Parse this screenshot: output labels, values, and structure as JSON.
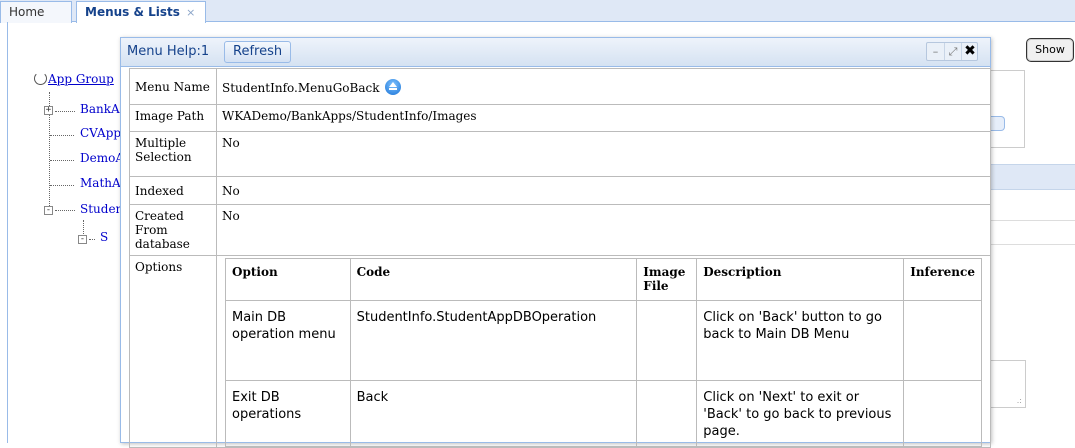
{
  "tabs": [
    {
      "label": "Home"
    },
    {
      "label": "Menus & Lists",
      "close": "×"
    }
  ],
  "background": {
    "tree_root_label": "App Group",
    "tree_items": [
      "BankA",
      "CVApp",
      "DemoA",
      "MathA",
      "Student",
      "S"
    ],
    "show_button": "Show"
  },
  "dialog": {
    "title": "Menu Help:1",
    "refresh_label": "Refresh",
    "tools": {
      "minimize": "–",
      "maximize": "⤢",
      "close": "✖"
    },
    "properties": {
      "menu_name": {
        "label": "Menu Name",
        "value": "StudentInfo.MenuGoBack",
        "icon": "go-back-icon"
      },
      "image_path": {
        "label": "Image Path",
        "value": "WKADemo/BankApps/StudentInfo/Images"
      },
      "multiple_selection": {
        "label": "Multiple Selection",
        "value": "No"
      },
      "indexed": {
        "label": "Indexed",
        "value": "No"
      },
      "created_from_database": {
        "label": "Created From database",
        "value": "No"
      },
      "options": {
        "label": "Options"
      }
    },
    "options_table": {
      "headers": [
        "Option",
        "Code",
        "Image File",
        "Description",
        "Inference"
      ],
      "rows": [
        [
          "Main DB operation menu",
          "StudentInfo.StudentAppDBOperation",
          "",
          "Click on 'Back' button to go back to Main DB Menu",
          ""
        ],
        [
          "Exit DB operations",
          "Back",
          "",
          "Click on 'Next' to exit or 'Back' to go back to previous page.",
          ""
        ]
      ]
    }
  },
  "colors": {
    "header_bg": "#dfe8f6",
    "border": "#99bbe8",
    "title_text": "#15428b",
    "link": "#0000cc"
  }
}
